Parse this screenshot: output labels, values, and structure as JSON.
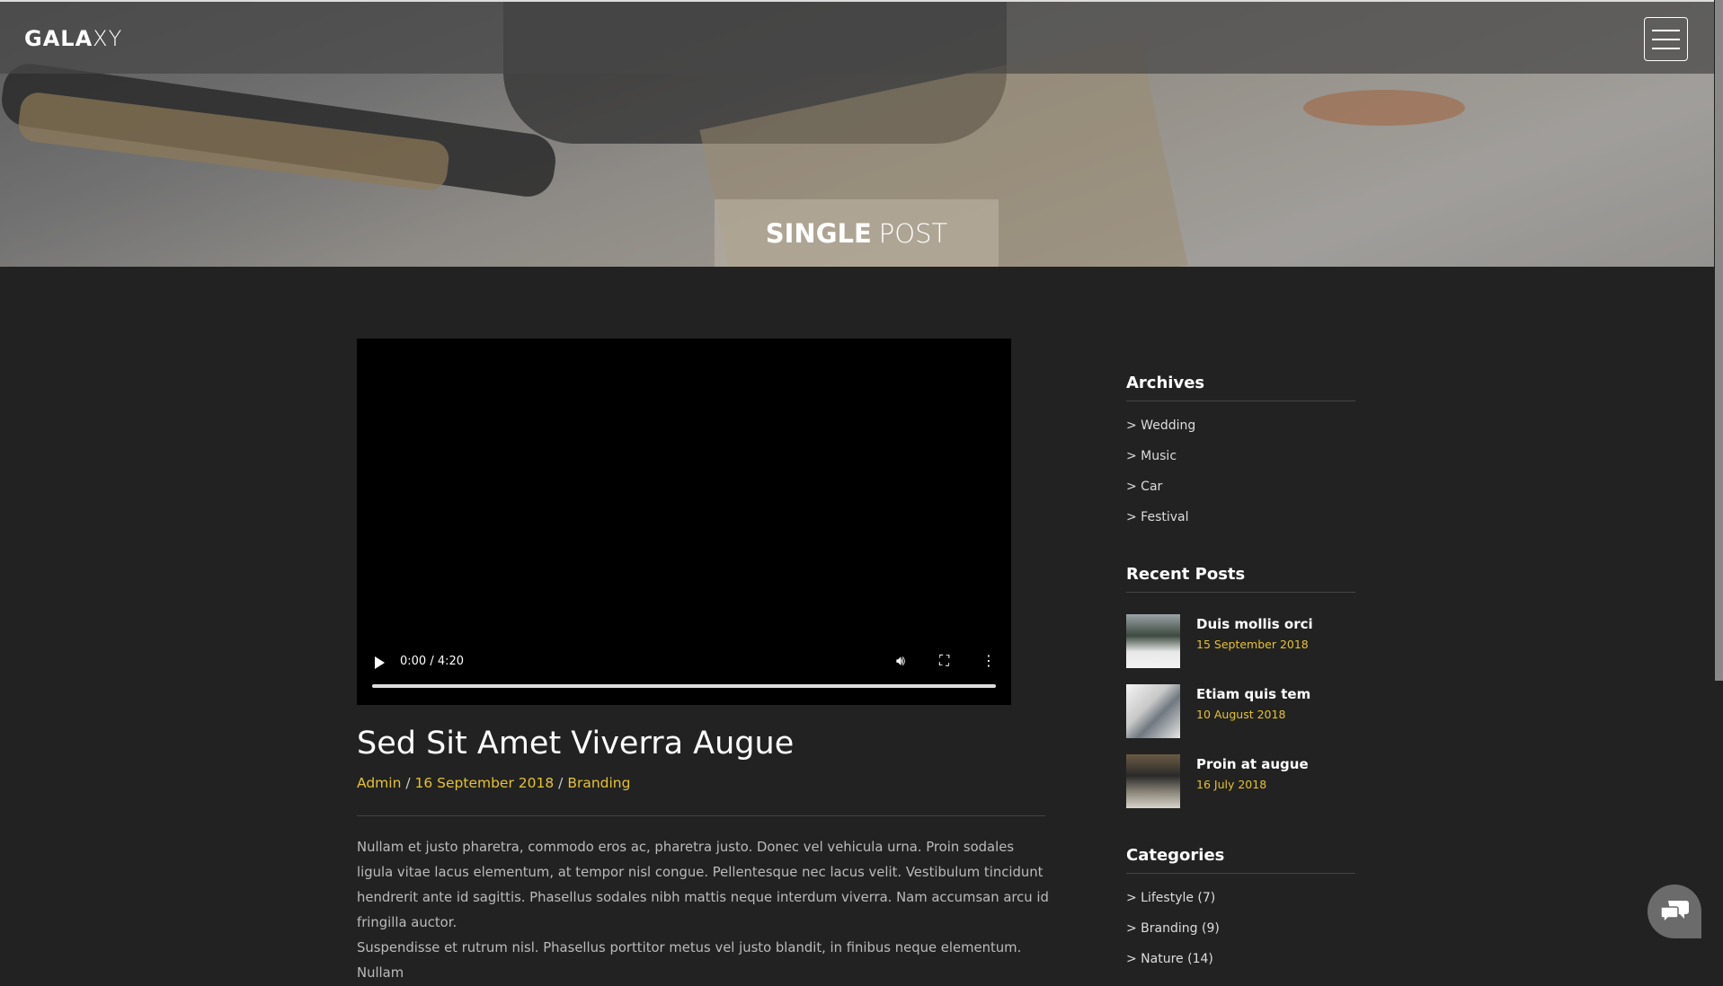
{
  "header": {
    "logo_bold": "GALA",
    "logo_light": "XY",
    "menu_icon": "hamburger-icon"
  },
  "hero": {
    "title_bold": "SINGLE",
    "title_light": "POST"
  },
  "video": {
    "time": "0:00 / 4:20",
    "progress": 0
  },
  "post": {
    "title": "Sed Sit Amet Viverra Augue",
    "author": "Admin",
    "date": "16 September 2018",
    "category": "Branding",
    "sep": "/",
    "paragraphs": [
      "Nullam et justo pharetra, commodo eros ac, pharetra justo. Donec vel vehicula urna. Proin sodales ligula vitae lacus elementum, at tempor nisl congue. Pellentesque nec lacus velit. Vestibulum tincidunt hendrerit ante id sagittis. Phasellus sodales nibh mattis neque interdum viverra. Nam accumsan arcu id fringilla auctor.",
      "Suspendisse et rutrum nisl. Phasellus porttitor metus vel justo blandit, in finibus neque elementum. Nullam"
    ]
  },
  "sidebar": {
    "archives": {
      "title": "Archives",
      "items": [
        "> Wedding",
        "> Music",
        "> Car",
        "> Festival"
      ]
    },
    "recent": {
      "title": "Recent Posts",
      "items": [
        {
          "title": "Duis mollis orci",
          "date": "15 September 2018"
        },
        {
          "title": "Etiam quis tem",
          "date": "10 August 2018"
        },
        {
          "title": "Proin at augue",
          "date": "16 July 2018"
        }
      ]
    },
    "categories": {
      "title": "Categories",
      "items": [
        "> Lifestyle (7)",
        "> Branding (9)",
        "> Nature (14)"
      ]
    }
  },
  "colors": {
    "accent": "#e5c32f",
    "background": "#222222"
  }
}
